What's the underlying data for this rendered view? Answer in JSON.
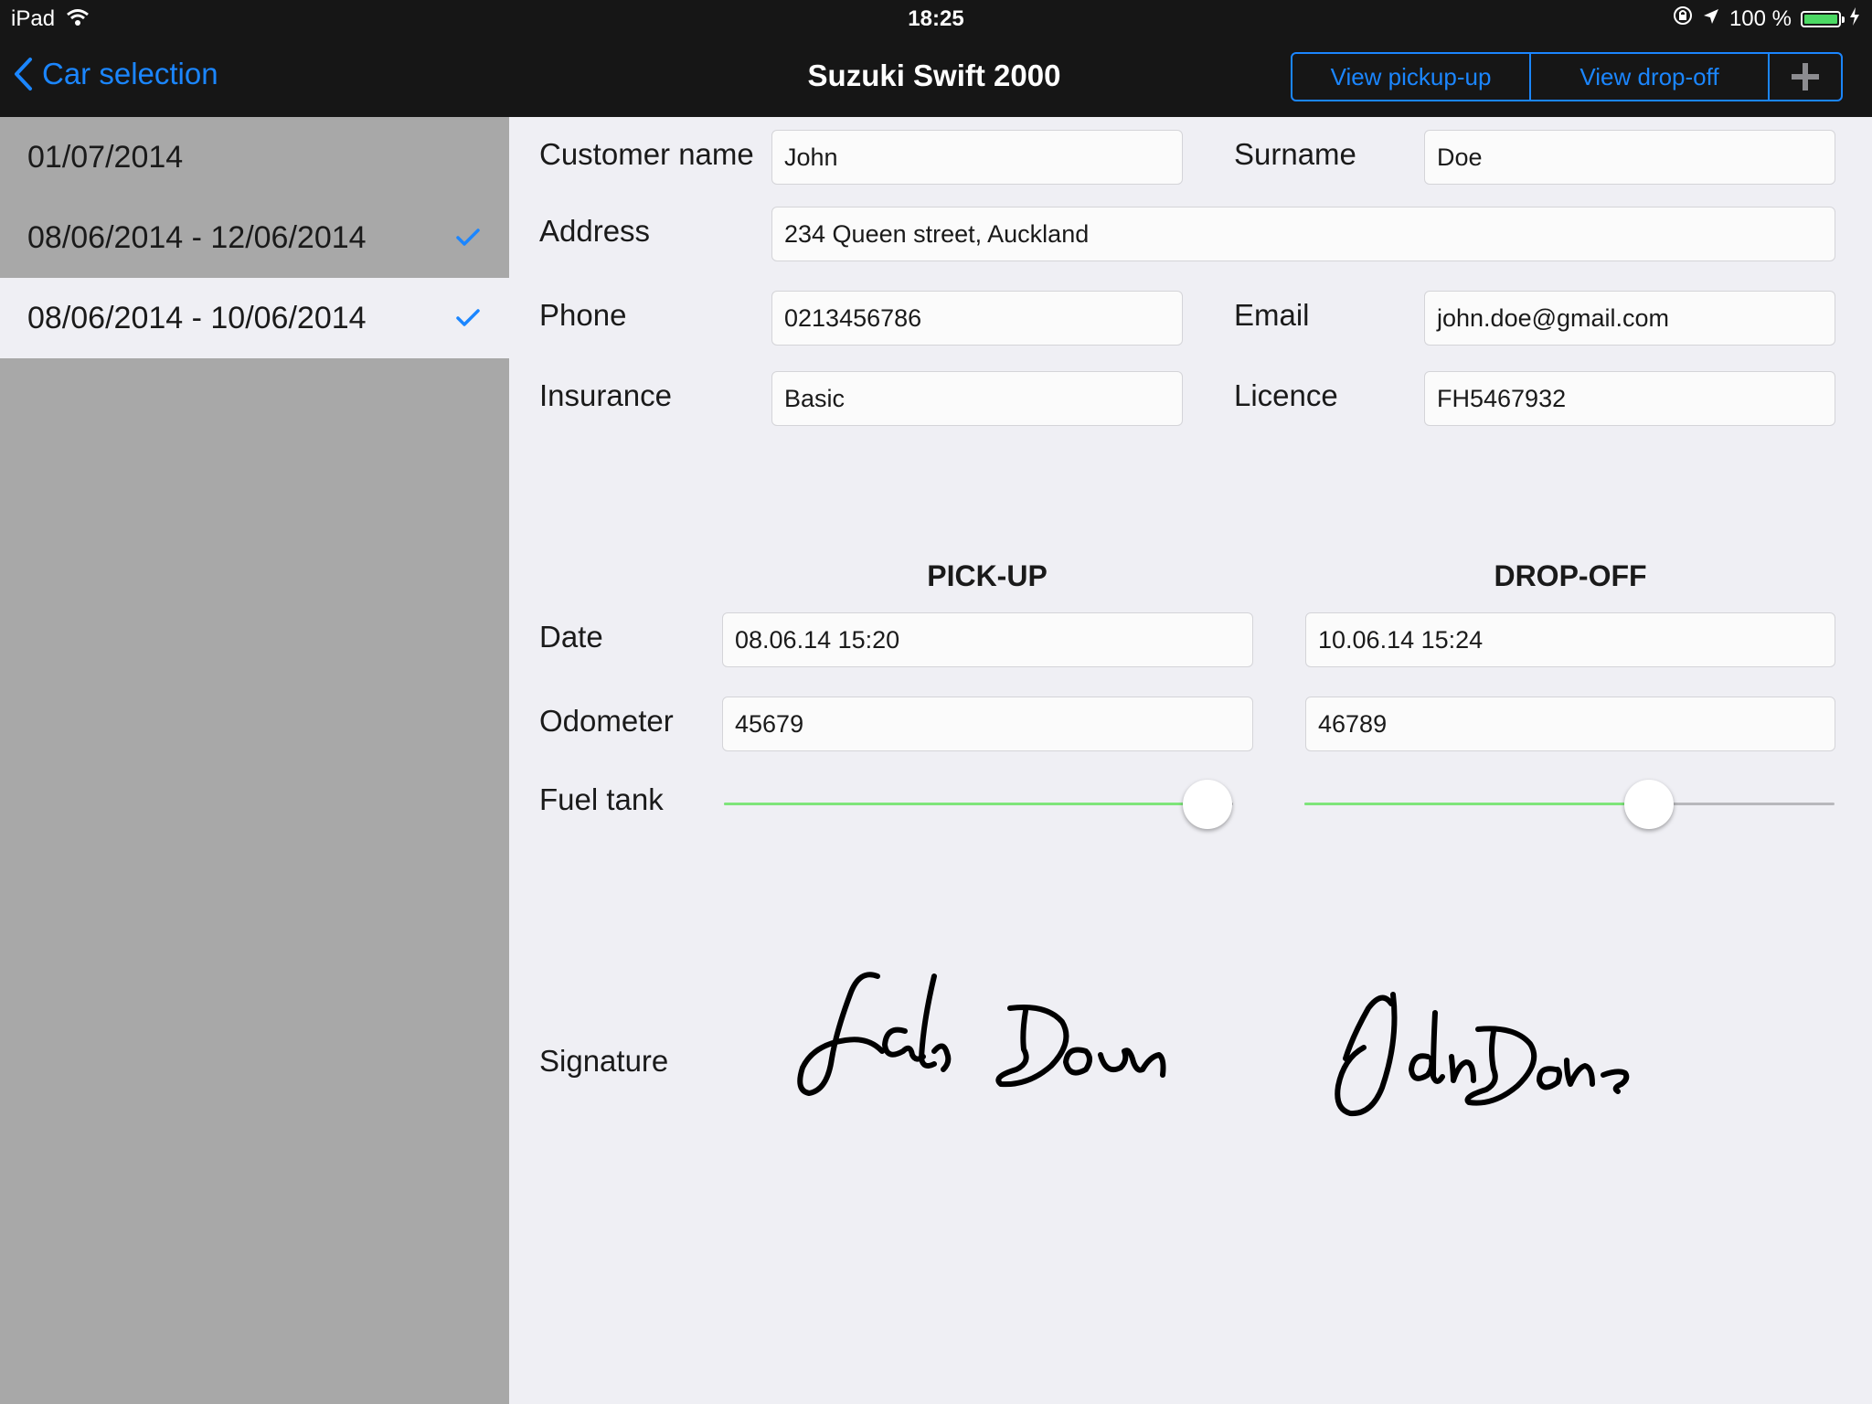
{
  "status_bar": {
    "device": "iPad",
    "time": "18:25",
    "battery": "100 %",
    "battery_level": 1.0,
    "icons": [
      "wifi-icon",
      "rotation-lock-icon",
      "location-icon",
      "battery-icon",
      "charging-icon"
    ]
  },
  "nav": {
    "back_label": "Car selection",
    "title": "Suzuki Swift 2000",
    "segments": {
      "pickup": "View pickup-up",
      "dropoff": "View drop-off",
      "add_icon": "plus-icon"
    }
  },
  "sidebar": {
    "items": [
      {
        "label": "01/07/2014",
        "checked": false,
        "selected": false
      },
      {
        "label": "08/06/2014 - 12/06/2014",
        "checked": true,
        "selected": false
      },
      {
        "label": "08/06/2014 - 10/06/2014",
        "checked": true,
        "selected": true
      }
    ]
  },
  "customer": {
    "name_label": "Customer name",
    "name_value": "John",
    "surname_label": "Surname",
    "surname_value": "Doe",
    "address_label": "Address",
    "address_value": "234 Queen street, Auckland",
    "phone_label": "Phone",
    "phone_value": "0213456786",
    "email_label": "Email",
    "email_value": "john.doe@gmail.com",
    "insurance_label": "Insurance",
    "insurance_value": "Basic",
    "licence_label": "Licence",
    "licence_value": "FH5467932"
  },
  "rental": {
    "pickup_heading": "PICK-UP",
    "dropoff_heading": "DROP-OFF",
    "date_label": "Date",
    "odometer_label": "Odometer",
    "fuel_label": "Fuel tank",
    "signature_label": "Signature",
    "pickup": {
      "date": "08.06.14 15:20",
      "odometer": "45679",
      "fuel_level": 0.95
    },
    "dropoff": {
      "date": "10.06.14 15:24",
      "odometer": "46789",
      "fuel_level": 0.65
    }
  },
  "colors": {
    "accent": "#1b86ff",
    "bar": "#161616",
    "sidebar": "#a8a8a8",
    "background": "#efeff4",
    "fuel_fill": "#7ee57a",
    "battery": "#4cd964"
  }
}
